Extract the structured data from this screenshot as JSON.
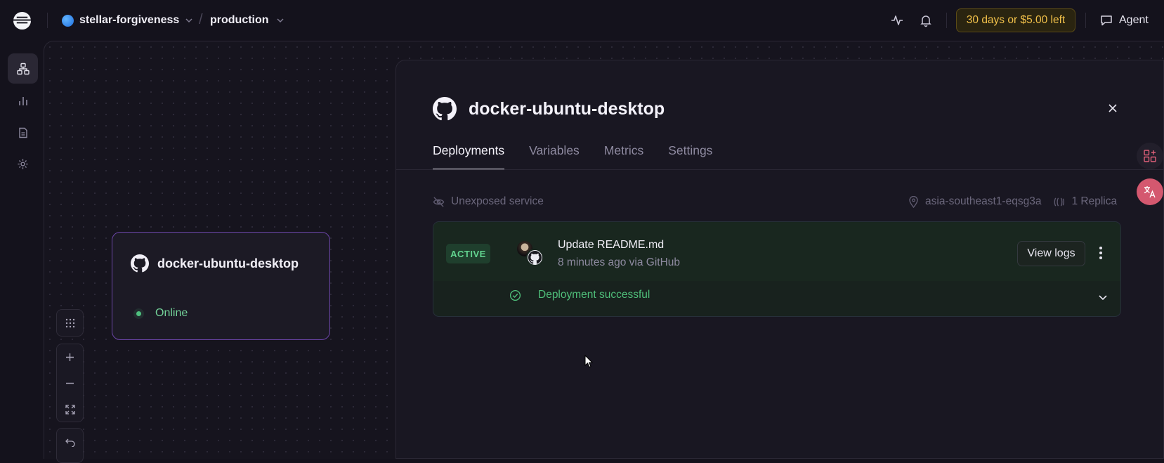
{
  "topbar": {
    "project_name": "stellar-forgiveness",
    "environment": "production",
    "trial_text": "30 days or $5.00 left",
    "agent_label": "Agent"
  },
  "sidebar": {
    "items": [
      {
        "name": "architecture",
        "icon": "architecture-icon",
        "active": true
      },
      {
        "name": "observability",
        "icon": "bar-chart-icon",
        "active": false
      },
      {
        "name": "logs",
        "icon": "document-icon",
        "active": false
      },
      {
        "name": "settings",
        "icon": "gear-icon",
        "active": false
      }
    ]
  },
  "canvas": {
    "service_card": {
      "name": "docker-ubuntu-desktop",
      "status": "Online"
    }
  },
  "panel": {
    "title": "docker-ubuntu-desktop",
    "tabs": [
      "Deployments",
      "Variables",
      "Metrics",
      "Settings"
    ],
    "active_tab": "Deployments",
    "exposure": "Unexposed service",
    "region": "asia-southeast1-eqsg3a",
    "replicas": "1 Replica",
    "deployment": {
      "badge": "ACTIVE",
      "commit_message": "Update README.md",
      "meta": "8 minutes ago via GitHub",
      "view_logs_label": "View logs",
      "status_text": "Deployment successful"
    }
  },
  "colors": {
    "accent_purple": "#6b45a8",
    "success_green": "#4fbf7a",
    "trial_yellow": "#f2c14a"
  }
}
